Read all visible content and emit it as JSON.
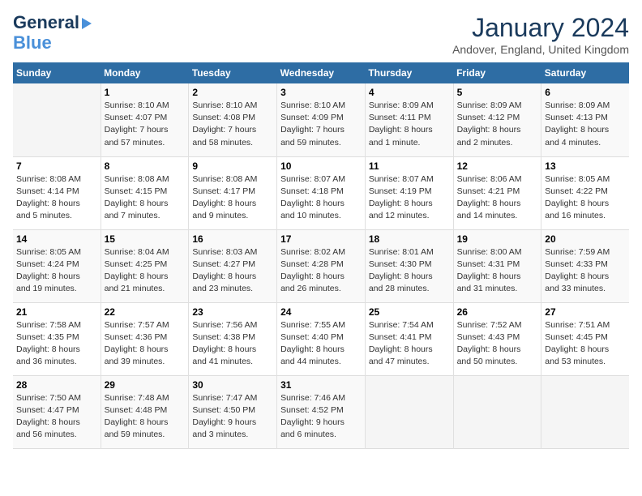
{
  "header": {
    "logo_line1": "General",
    "logo_line2": "Blue",
    "title": "January 2024",
    "subtitle": "Andover, England, United Kingdom"
  },
  "days_of_week": [
    "Sunday",
    "Monday",
    "Tuesday",
    "Wednesday",
    "Thursday",
    "Friday",
    "Saturday"
  ],
  "weeks": [
    [
      {
        "day": "",
        "info": ""
      },
      {
        "day": "1",
        "info": "Sunrise: 8:10 AM\nSunset: 4:07 PM\nDaylight: 7 hours\nand 57 minutes."
      },
      {
        "day": "2",
        "info": "Sunrise: 8:10 AM\nSunset: 4:08 PM\nDaylight: 7 hours\nand 58 minutes."
      },
      {
        "day": "3",
        "info": "Sunrise: 8:10 AM\nSunset: 4:09 PM\nDaylight: 7 hours\nand 59 minutes."
      },
      {
        "day": "4",
        "info": "Sunrise: 8:09 AM\nSunset: 4:11 PM\nDaylight: 8 hours\nand 1 minute."
      },
      {
        "day": "5",
        "info": "Sunrise: 8:09 AM\nSunset: 4:12 PM\nDaylight: 8 hours\nand 2 minutes."
      },
      {
        "day": "6",
        "info": "Sunrise: 8:09 AM\nSunset: 4:13 PM\nDaylight: 8 hours\nand 4 minutes."
      }
    ],
    [
      {
        "day": "7",
        "info": "Sunrise: 8:08 AM\nSunset: 4:14 PM\nDaylight: 8 hours\nand 5 minutes."
      },
      {
        "day": "8",
        "info": "Sunrise: 8:08 AM\nSunset: 4:15 PM\nDaylight: 8 hours\nand 7 minutes."
      },
      {
        "day": "9",
        "info": "Sunrise: 8:08 AM\nSunset: 4:17 PM\nDaylight: 8 hours\nand 9 minutes."
      },
      {
        "day": "10",
        "info": "Sunrise: 8:07 AM\nSunset: 4:18 PM\nDaylight: 8 hours\nand 10 minutes."
      },
      {
        "day": "11",
        "info": "Sunrise: 8:07 AM\nSunset: 4:19 PM\nDaylight: 8 hours\nand 12 minutes."
      },
      {
        "day": "12",
        "info": "Sunrise: 8:06 AM\nSunset: 4:21 PM\nDaylight: 8 hours\nand 14 minutes."
      },
      {
        "day": "13",
        "info": "Sunrise: 8:05 AM\nSunset: 4:22 PM\nDaylight: 8 hours\nand 16 minutes."
      }
    ],
    [
      {
        "day": "14",
        "info": "Sunrise: 8:05 AM\nSunset: 4:24 PM\nDaylight: 8 hours\nand 19 minutes."
      },
      {
        "day": "15",
        "info": "Sunrise: 8:04 AM\nSunset: 4:25 PM\nDaylight: 8 hours\nand 21 minutes."
      },
      {
        "day": "16",
        "info": "Sunrise: 8:03 AM\nSunset: 4:27 PM\nDaylight: 8 hours\nand 23 minutes."
      },
      {
        "day": "17",
        "info": "Sunrise: 8:02 AM\nSunset: 4:28 PM\nDaylight: 8 hours\nand 26 minutes."
      },
      {
        "day": "18",
        "info": "Sunrise: 8:01 AM\nSunset: 4:30 PM\nDaylight: 8 hours\nand 28 minutes."
      },
      {
        "day": "19",
        "info": "Sunrise: 8:00 AM\nSunset: 4:31 PM\nDaylight: 8 hours\nand 31 minutes."
      },
      {
        "day": "20",
        "info": "Sunrise: 7:59 AM\nSunset: 4:33 PM\nDaylight: 8 hours\nand 33 minutes."
      }
    ],
    [
      {
        "day": "21",
        "info": "Sunrise: 7:58 AM\nSunset: 4:35 PM\nDaylight: 8 hours\nand 36 minutes."
      },
      {
        "day": "22",
        "info": "Sunrise: 7:57 AM\nSunset: 4:36 PM\nDaylight: 8 hours\nand 39 minutes."
      },
      {
        "day": "23",
        "info": "Sunrise: 7:56 AM\nSunset: 4:38 PM\nDaylight: 8 hours\nand 41 minutes."
      },
      {
        "day": "24",
        "info": "Sunrise: 7:55 AM\nSunset: 4:40 PM\nDaylight: 8 hours\nand 44 minutes."
      },
      {
        "day": "25",
        "info": "Sunrise: 7:54 AM\nSunset: 4:41 PM\nDaylight: 8 hours\nand 47 minutes."
      },
      {
        "day": "26",
        "info": "Sunrise: 7:52 AM\nSunset: 4:43 PM\nDaylight: 8 hours\nand 50 minutes."
      },
      {
        "day": "27",
        "info": "Sunrise: 7:51 AM\nSunset: 4:45 PM\nDaylight: 8 hours\nand 53 minutes."
      }
    ],
    [
      {
        "day": "28",
        "info": "Sunrise: 7:50 AM\nSunset: 4:47 PM\nDaylight: 8 hours\nand 56 minutes."
      },
      {
        "day": "29",
        "info": "Sunrise: 7:48 AM\nSunset: 4:48 PM\nDaylight: 8 hours\nand 59 minutes."
      },
      {
        "day": "30",
        "info": "Sunrise: 7:47 AM\nSunset: 4:50 PM\nDaylight: 9 hours\nand 3 minutes."
      },
      {
        "day": "31",
        "info": "Sunrise: 7:46 AM\nSunset: 4:52 PM\nDaylight: 9 hours\nand 6 minutes."
      },
      {
        "day": "",
        "info": ""
      },
      {
        "day": "",
        "info": ""
      },
      {
        "day": "",
        "info": ""
      }
    ]
  ]
}
